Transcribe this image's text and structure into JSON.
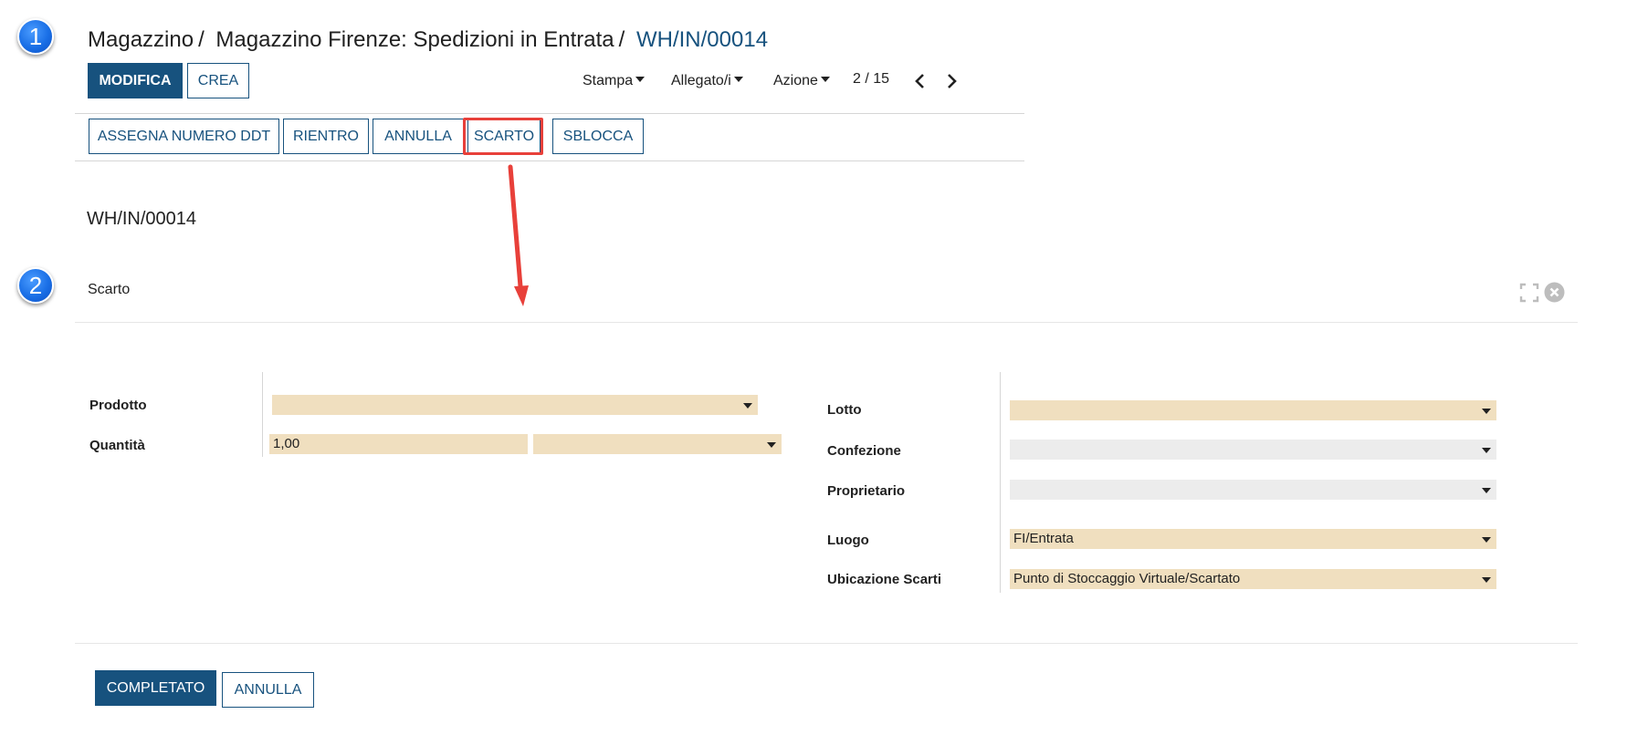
{
  "badges": {
    "step1": "1",
    "step2": "2"
  },
  "breadcrumb": {
    "item1": "Magazzino",
    "item2": "Magazzino Firenze: Spedizioni in Entrata",
    "sep": "/",
    "current": "WH/IN/00014"
  },
  "toolbar": {
    "edit_label": "MODIFICA",
    "create_label": "CREA"
  },
  "menus": {
    "print": "Stampa",
    "attachments": "Allegato/i",
    "action": "Azione"
  },
  "pager": {
    "text": "2 / 15"
  },
  "statusbar": {
    "assign_ddt": "ASSEGNA NUMERO DDT",
    "return": "RIENTRO",
    "cancel": "ANNULLA",
    "scrap": "SCARTO",
    "unlock": "SBLOCCA"
  },
  "record": {
    "title": "WH/IN/00014"
  },
  "dialog": {
    "title": "Scarto",
    "left": {
      "product_label": "Prodotto",
      "product_value": "",
      "quantity_label": "Quantità",
      "quantity_value": "1,00",
      "uom_value": ""
    },
    "right": {
      "lot_label": "Lotto",
      "lot_value": "",
      "package_label": "Confezione",
      "package_value": "",
      "owner_label": "Proprietario",
      "owner_value": "",
      "location_label": "Luogo",
      "location_value": "FI/Entrata",
      "scrap_location_label": "Ubicazione Scarti",
      "scrap_location_value": "Punto di Stoccaggio Virtuale/Scartato"
    },
    "footer": {
      "done_label": "COMPLETATO",
      "cancel_label": "ANNULLA"
    }
  },
  "colors": {
    "primary": "#17527e",
    "required_field": "#f0dfbf",
    "readonly_field": "#ececec",
    "highlight": "#e8403a",
    "badge": "#1a6fe6"
  },
  "icons": {
    "expand": "expand-icon",
    "close": "close-circle-icon",
    "prev": "chevron-left-icon",
    "next": "chevron-right-icon"
  }
}
